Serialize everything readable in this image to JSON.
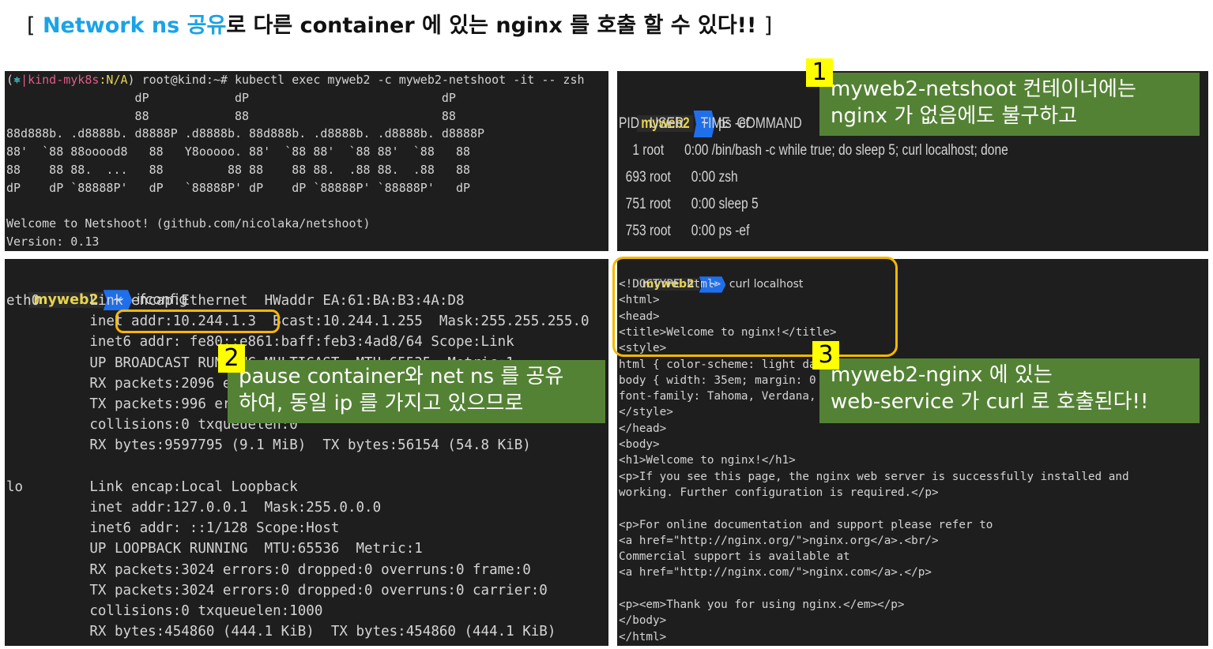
{
  "heading": {
    "open": "[",
    "blue": "Network ns 공유",
    "rest": "로 다른 container 에 있는 nginx 를 호출 할 수 있다!!",
    "close": "]"
  },
  "term1": {
    "prompt_ctx_a": "(",
    "prompt_ctx_sym": "⎈",
    "prompt_ctx_b": "|kind-myk8s",
    "prompt_ctx_c": ":N/A",
    "prompt_ctx_d": ")",
    "command": " root@kind:~# kubectl exec myweb2 -c myweb2-netshoot -it -- zsh",
    "lines": [
      "                  dP            dP                           dP",
      "                  88            88                           88",
      "88d888b. .d8888b. d8888P .d8888b. 88d888b. .d8888b. .d8888b. d8888P",
      "88'  `88 88ooood8   88   Y8ooooo. 88'  `88 88'  `88 88'  `88   88",
      "88    88 88.  ...   88         88 88    88 88.  .88 88.  .88   88",
      "dP    dP `88888P'   dP   `88888P' dP    dP `88888P' `88888P'   dP",
      "",
      "Welcome to Netshoot! (github.com/nicolaka/netshoot)",
      "Version: 0.13"
    ]
  },
  "term2": {
    "prompt_name": "myweb2",
    "prompt_dir": "~",
    "command": "ps -ef",
    "header": "PID   USER     TIME  COMMAND",
    "rows": [
      "    1 root      0:00 /bin/bash -c while true; do sleep 5; curl localhost; done",
      "  693 root      0:00 zsh",
      "  751 root      0:00 sleep 5",
      "  753 root      0:00 ps -ef"
    ]
  },
  "term3": {
    "prompt_name": "myweb2",
    "prompt_dir": "~",
    "command": "ifconfig",
    "lines": [
      "eth0      Link encap:Ethernet  HWaddr EA:61:BA:B3:4A:D8",
      "          inet addr:10.244.1.3  Bcast:10.244.1.255  Mask:255.255.255.0",
      "          inet6 addr: fe80::e861:baff:feb3:4ad8/64 Scope:Link",
      "          UP BROADCAST RUNNING MULTICAST  MTU:65535  Metric:1",
      "          RX packets:2096 errors:0 dropped:0 overruns:0 frame:0",
      "          TX packets:996 errors:0 dropped:0 overruns:0 carrier:0",
      "          collisions:0 txqueuelen:0",
      "          RX bytes:9597795 (9.1 MiB)  TX bytes:56154 (54.8 KiB)",
      "",
      "lo        Link encap:Local Loopback",
      "          inet addr:127.0.0.1  Mask:255.0.0.0",
      "          inet6 addr: ::1/128 Scope:Host",
      "          UP LOOPBACK RUNNING  MTU:65536  Metric:1",
      "          RX packets:3024 errors:0 dropped:0 overruns:0 frame:0",
      "          TX packets:3024 errors:0 dropped:0 overruns:0 carrier:0",
      "          collisions:0 txqueuelen:1000",
      "          RX bytes:454860 (444.1 KiB)  TX bytes:454860 (444.1 KiB)"
    ]
  },
  "term4": {
    "prompt_name": "myweb2",
    "prompt_dir": "~",
    "command": "curl localhost",
    "lines": [
      "<!DOCTYPE html>",
      "<html>",
      "<head>",
      "<title>Welcome to nginx!</title>",
      "<style>",
      "html { color-scheme: light dark; }",
      "body { width: 35em; margin: 0 auto;",
      "font-family: Tahoma, Verdana, Arial, sans-serif; }",
      "</style>",
      "</head>",
      "<body>",
      "<h1>Welcome to nginx!</h1>",
      "<p>If you see this page, the nginx web server is successfully installed and",
      "working. Further configuration is required.</p>",
      "",
      "<p>For online documentation and support please refer to",
      "<a href=\"http://nginx.org/\">nginx.org</a>.<br/>",
      "Commercial support is available at",
      "<a href=\"http://nginx.com/\">nginx.com</a>.</p>",
      "",
      "<p><em>Thank you for using nginx.</em></p>",
      "</body>",
      "</html>"
    ]
  },
  "callouts": {
    "c1": {
      "num": "1",
      "line1": "myweb2-netshoot 컨테이너에는",
      "line2": "nginx 가 없음에도 불구하고"
    },
    "c2": {
      "num": "2",
      "line1": "pause container와 net ns 를 공유",
      "line2": "하여, 동일 ip 를 가지고 있으므로"
    },
    "c3": {
      "num": "3",
      "line1": "myweb2-nginx 에 있는",
      "line2": "web-service 가 curl 로 호출된다!!"
    }
  },
  "colors": {
    "callout_bg": "#548235",
    "number_bg": "#ffff00",
    "highlight": "#f5b800",
    "heading_accent": "#1aa3e8"
  }
}
